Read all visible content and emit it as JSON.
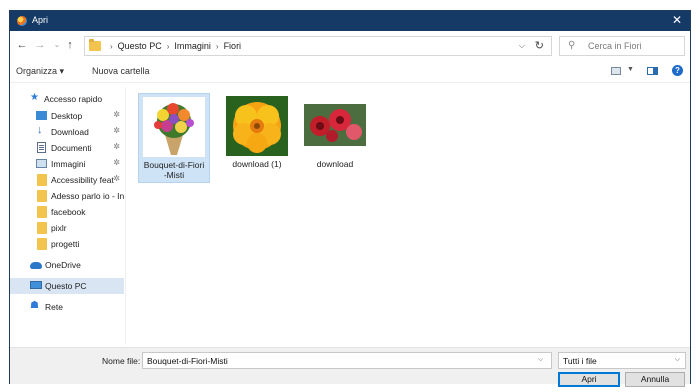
{
  "window": {
    "title": "Apri",
    "close_glyph": "✕"
  },
  "nav": {
    "back": "←",
    "forward": "→",
    "dropdown": "⌄",
    "up": "↑"
  },
  "address": {
    "crumbs": [
      "Questo PC",
      "Immagini",
      "Fiori"
    ],
    "separator": "›"
  },
  "search": {
    "placeholder": "Cerca in Fiori"
  },
  "toolbar": {
    "organize": "Organizza ▾",
    "new_folder": "Nuova cartella",
    "help": "?"
  },
  "sidebar": {
    "items": [
      {
        "label": "Accesso rapido",
        "icon": "star-icon"
      },
      {
        "label": "Desktop",
        "icon": "desktop-icon",
        "pinned": true
      },
      {
        "label": "Download",
        "icon": "download-icon",
        "pinned": true
      },
      {
        "label": "Documenti",
        "icon": "documents-icon",
        "pinned": true
      },
      {
        "label": "Immagini",
        "icon": "pictures-icon",
        "pinned": true
      },
      {
        "label": "Accessibility feat",
        "icon": "folder-icon",
        "pinned": true
      },
      {
        "label": "Adesso parlo io - In",
        "icon": "folder-icon"
      },
      {
        "label": "facebook",
        "icon": "folder-icon"
      },
      {
        "label": "pixlr",
        "icon": "folder-icon"
      },
      {
        "label": "progetti",
        "icon": "folder-icon"
      },
      {
        "label": "OneDrive",
        "icon": "onedrive-icon"
      },
      {
        "label": "Questo PC",
        "icon": "this-pc-icon",
        "selected": true
      },
      {
        "label": "Rete",
        "icon": "network-icon"
      }
    ]
  },
  "files": [
    {
      "name": "Bouquet-di-Fiori\n-Misti",
      "selected": true
    },
    {
      "name": "download (1)"
    },
    {
      "name": "download"
    }
  ],
  "footer": {
    "filename_label": "Nome file:",
    "filename_value": "Bouquet-di-Fiori-Misti",
    "filetype": "Tutti i file",
    "open_label": "Apri",
    "cancel_label": "Annulla"
  },
  "colors": {
    "titlebar": "#163a66",
    "selection": "#cfe3f7",
    "accent": "#0078d7"
  }
}
